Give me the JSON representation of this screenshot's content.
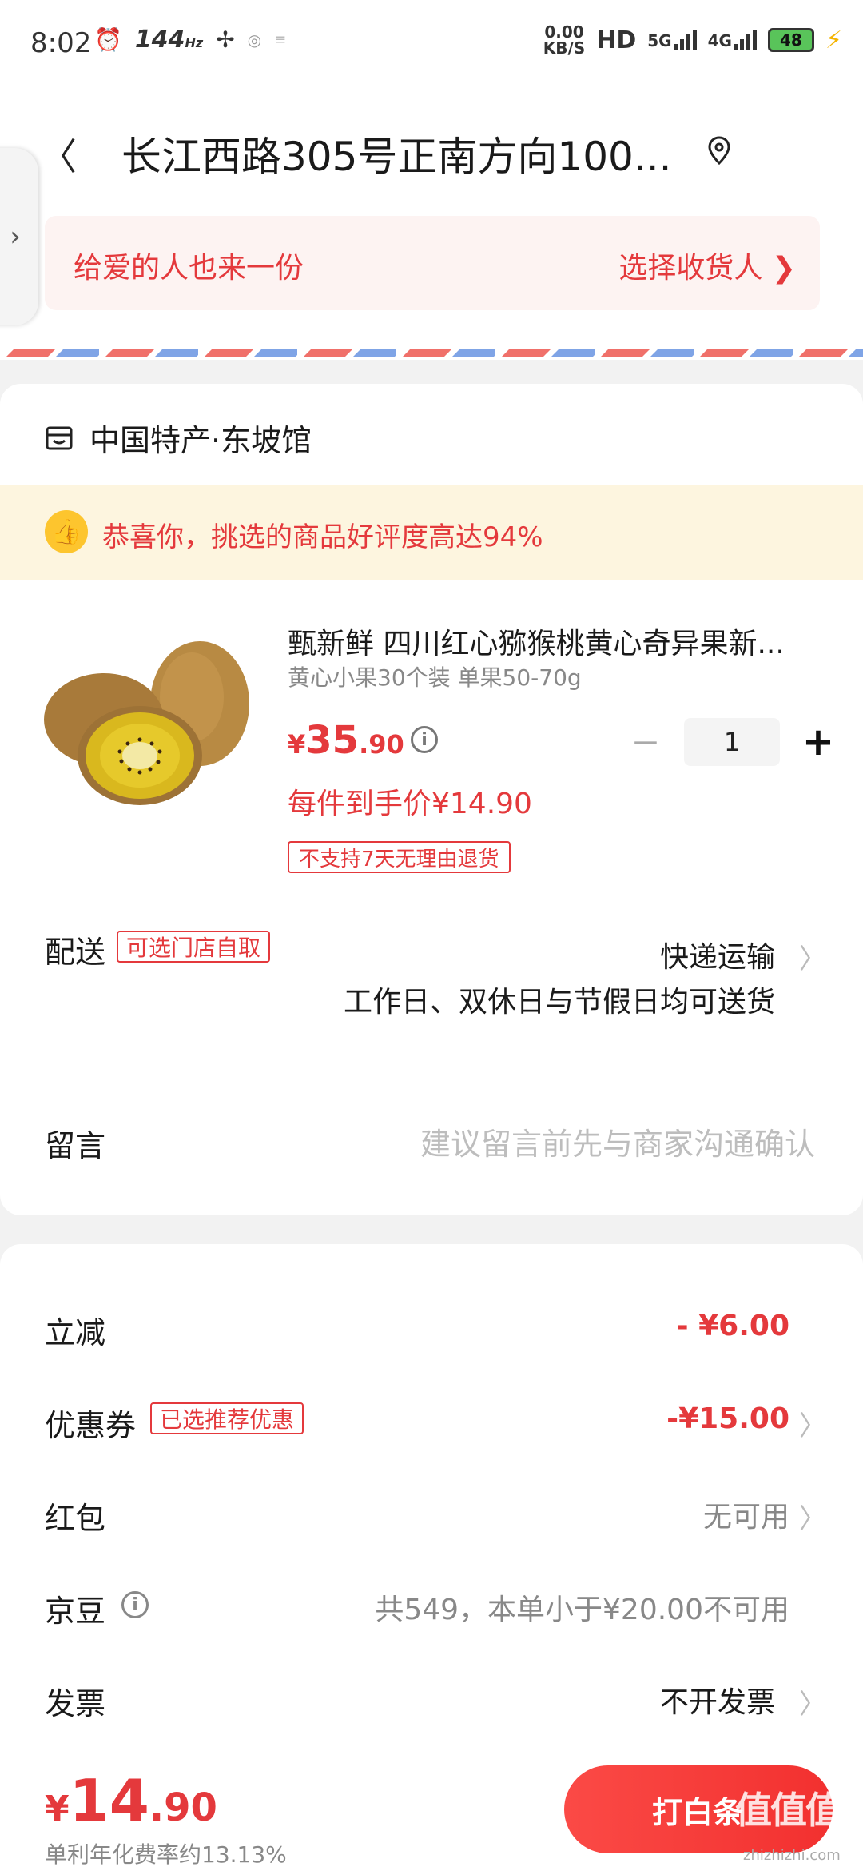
{
  "status_bar": {
    "time": "8:02",
    "refresh": "144",
    "refresh_unit": "Hz",
    "net_speed_value": "0.00",
    "net_speed_unit": "KB/S",
    "hd": "HD",
    "net1": "5G",
    "net2": "4G",
    "battery": "48"
  },
  "header": {
    "address": "长江西路305号正南方向100..."
  },
  "gift": {
    "left": "给爱的人也来一份",
    "right": "选择收货人 ❯"
  },
  "store": {
    "name": "中国特产·东坡馆",
    "rating_text": "恭喜你，挑选的商品好评度高达94%"
  },
  "product": {
    "title": "甄新鲜 四川红心猕猴桃黄心奇异果新...",
    "spec": "黄心小果30个装 单果50-70g",
    "price_currency": "¥",
    "price_int": "35",
    "price_dec": ".90",
    "quantity": "1",
    "final_price": "每件到手价¥14.90",
    "return_tag": "不支持7天无理由退货"
  },
  "delivery": {
    "label": "配送",
    "badge": "可选门店自取",
    "method": "快递运输",
    "desc": "工作日、双休日与节假日均可送货"
  },
  "note": {
    "label": "留言",
    "placeholder": "建议留言前先与商家沟通确认"
  },
  "discounts": {
    "instant_label": "立减",
    "instant_value": "- ¥6.00",
    "coupon_label": "优惠券",
    "coupon_badge": "已选推荐优惠",
    "coupon_value": "-¥15.00",
    "redpacket_label": "红包",
    "redpacket_value": "无可用",
    "beans_label": "京豆",
    "beans_value": "共549，本单小于¥20.00不可用",
    "invoice_label": "发票",
    "invoice_value": "不开发票"
  },
  "footer": {
    "currency": "¥",
    "total_int": "14",
    "total_dec": ".90",
    "apr": "单利年化费率约13.13%",
    "pay_button": "打白条",
    "watermark": "值值值",
    "watermark_sub": "zhizhizhi.com"
  },
  "colors": {
    "accent": "#e4393c",
    "rating_bg": "#fdf5df",
    "gift_bg": "#fdf3f2"
  }
}
